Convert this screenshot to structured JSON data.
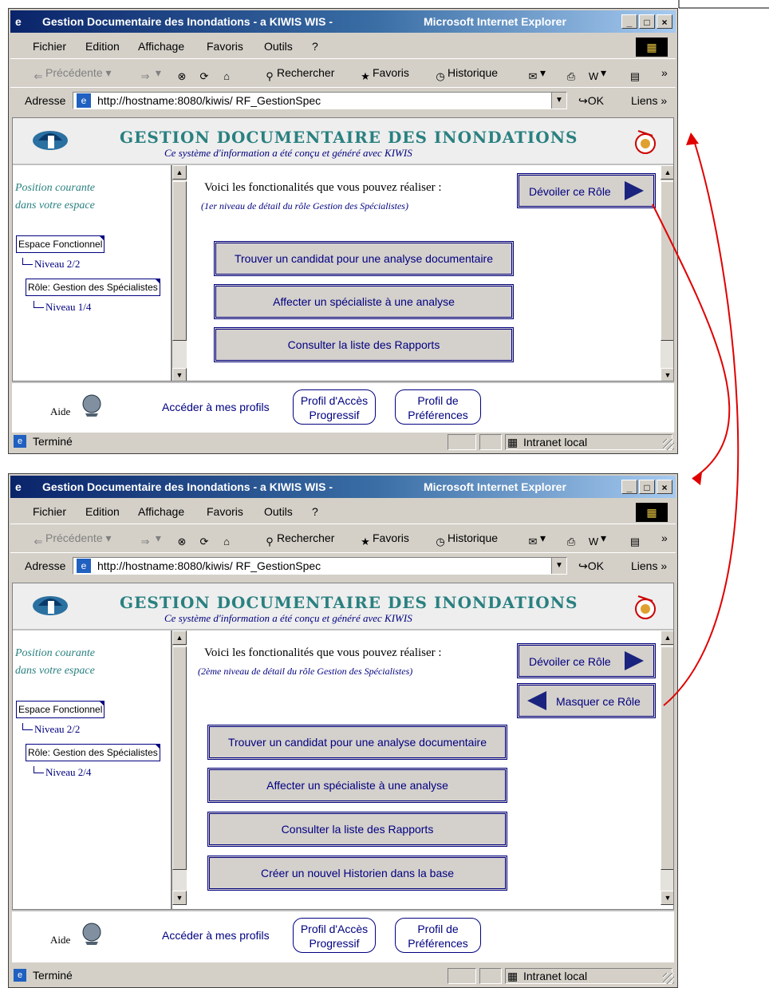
{
  "browser": {
    "title": "Gestion Documentaire des Inondations - a KIWIS WIS -",
    "app": "Microsoft Internet Explorer",
    "menu": [
      "Fichier",
      "Edition",
      "Affichage",
      "Favoris",
      "Outils",
      "?"
    ],
    "toolbar": {
      "back": "Précédente",
      "search": "Rechercher",
      "favorites": "Favoris",
      "history": "Historique"
    },
    "address_label": "Adresse",
    "url": "http://hostname:8080/kiwis/ RF_GestionSpec",
    "go": "OK",
    "links": "Liens",
    "status": "Terminé",
    "zone": "Intranet local"
  },
  "banner": {
    "title": "GESTION DOCUMENTAIRE DES INONDATIONS",
    "subtitle": "Ce système d'information a été conçu et généré avec KIWIS"
  },
  "nav": {
    "position_line1": "Position courante",
    "position_line2": "dans votre espace",
    "espace": "Espace Fonctionnel",
    "niveau_espace": "Niveau 2/2",
    "role": "Rôle: Gestion des Spécialistes"
  },
  "main": {
    "intro": "Voici les fonctionalités que vous pouvez réaliser :",
    "reveal_role": "Dévoiler ce Rôle",
    "hide_role": "Masquer ce Rôle"
  },
  "footer": {
    "aide": "Aide",
    "profiles": "Accéder à mes profils",
    "profil_acces_l1": "Profil d'Accès",
    "profil_acces_l2": "Progressif",
    "profil_pref_l1": "Profil de",
    "profil_pref_l2": "Préférences"
  },
  "screen1": {
    "niveau_role": "Niveau 1/4",
    "intro_sub": "(1er niveau de détail du rôle Gestion des Spécialistes)",
    "functions": [
      "Trouver un candidat pour une analyse documentaire",
      "Affecter un spécialiste à une analyse",
      "Consulter la liste des Rapports"
    ]
  },
  "screen2": {
    "niveau_role": "Niveau 2/4",
    "intro_sub": "(2ème niveau de détail du rôle Gestion des Spécialistes)",
    "functions": [
      "Trouver un candidat pour une analyse documentaire",
      "Affecter un spécialiste à une analyse",
      "Consulter la liste des Rapports",
      "Créer un nouvel Historien dans la base"
    ]
  },
  "colors": {
    "accent": "#000080",
    "teal": "#2a8080",
    "arrow": "#e00000"
  }
}
